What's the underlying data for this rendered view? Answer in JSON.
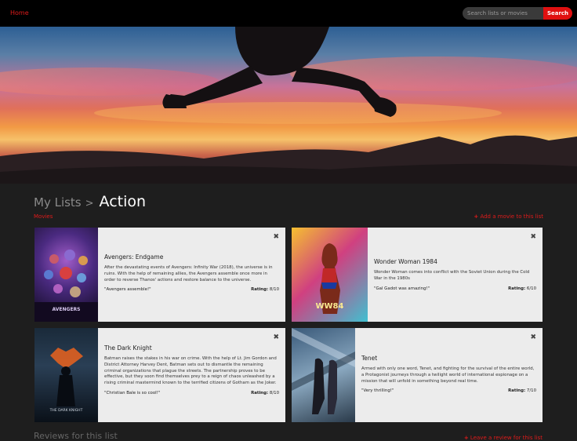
{
  "nav": {
    "home_label": "Home",
    "search_placeholder": "Search lists or movies",
    "search_button": "Search"
  },
  "breadcrumb": {
    "parent": "My Lists",
    "separator": ">",
    "current": "Action"
  },
  "section": {
    "label": "Movies",
    "add_movie_icon": "+",
    "add_movie_label": "Add a movie to this list"
  },
  "movies": [
    {
      "title": "Avengers: Endgame",
      "description": "After the devastating events of Avengers: Infinity War (2018), the universe is in ruins. With the help of remaining allies, the Avengers assemble once more in order to reverse Thanos' actions and restore balance to the universe.",
      "review": "\"Avengers assemble!\"",
      "rating_label": "Rating:",
      "rating": "8/10"
    },
    {
      "title": "Wonder Woman 1984",
      "description": "Wonder Woman comes into conflict with the Soviet Union during the Cold War in the 1980s",
      "review": "\"Gal Gadot was amazing!\"",
      "rating_label": "Rating:",
      "rating": "6/10"
    },
    {
      "title": "The Dark Knight",
      "description": "Batman raises the stakes in his war on crime. With the help of Lt. Jim Gordon and District Attorney Harvey Dent, Batman sets out to dismantle the remaining criminal organizations that plague the streets. The partnership proves to be effective, but they soon find themselves prey to a reign of chaos unleashed by a rising criminal mastermind known to the terrified citizens of Gotham as the Joker.",
      "review": "\"Christian Bale is so cool!\"",
      "rating_label": "Rating:",
      "rating": "8/10"
    },
    {
      "title": "Tenet",
      "description": "Armed with only one word, Tenet, and fighting for the survival of the entire world, a Protagonist journeys through a twilight world of international espionage on a mission that will unfold in something beyond real time.",
      "review": "\"Very thrilling!\"",
      "rating_label": "Rating:",
      "rating": "7/10"
    }
  ],
  "poster_text": {
    "avengers": "AVENGERS",
    "ww84": "WW84",
    "tdk": "THE DARK KNIGHT"
  },
  "close_icon": "close-icon",
  "reviews": {
    "title": "Reviews for this list",
    "leave_review_icon": "+",
    "leave_review_label": "Leave a review for this list"
  },
  "colors": {
    "accent": "#e01b1b",
    "card_bg": "#ececec",
    "page_bg": "#1e1e1e"
  }
}
